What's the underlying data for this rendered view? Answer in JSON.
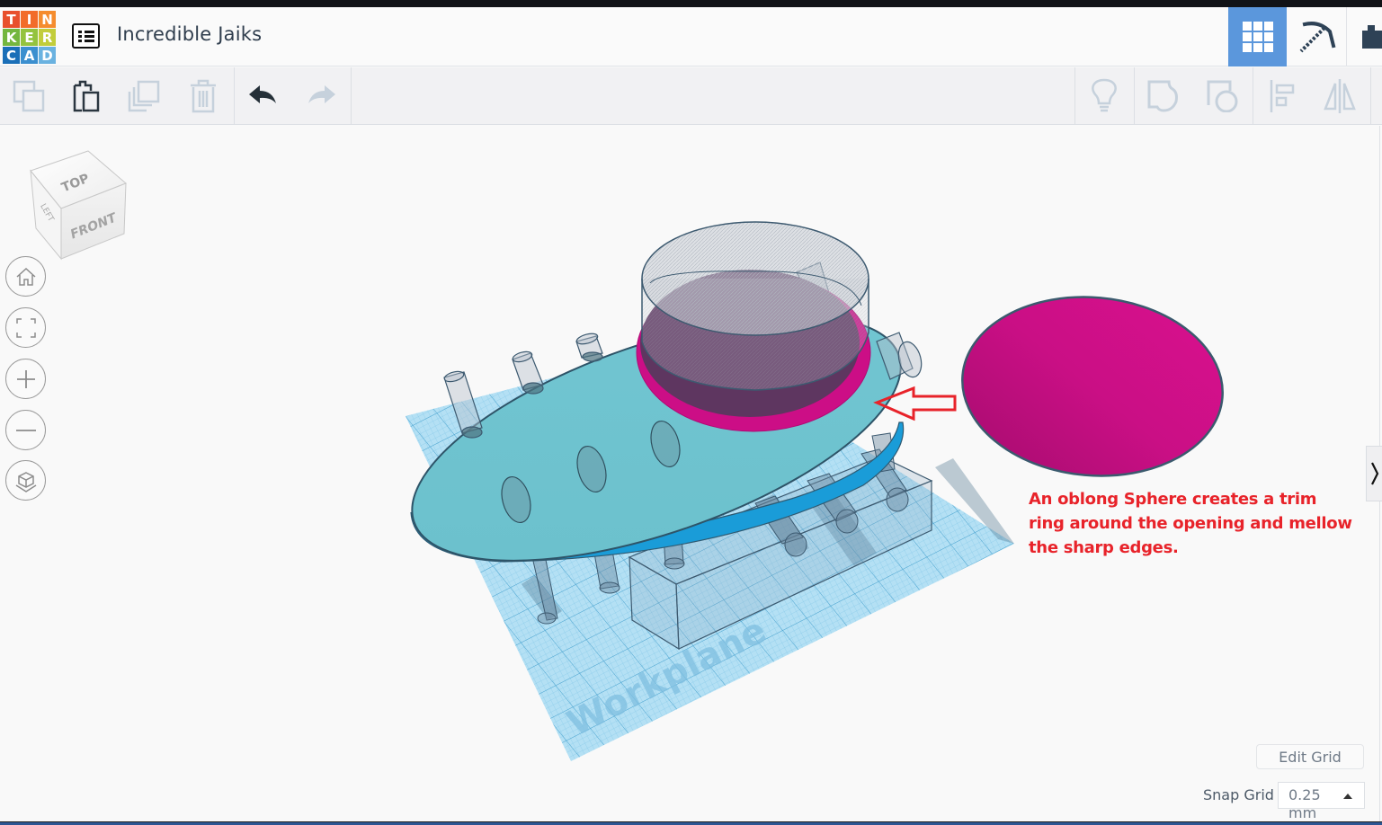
{
  "app": {
    "logo_letters": [
      "T",
      "I",
      "N",
      "K",
      "E",
      "R",
      "C",
      "A",
      "D"
    ],
    "logo_colors": [
      "#e8502d",
      "#f26c2a",
      "#f58c2e",
      "#74b63f",
      "#94c33e",
      "#c2cd3b",
      "#1a6fb8",
      "#3b8fcf",
      "#6ab2e0"
    ],
    "title": "Incredible Jaiks"
  },
  "view_tabs": [
    {
      "name": "3d-design",
      "icon": "grid-icon",
      "active": true
    },
    {
      "name": "blocks",
      "icon": "pickaxe-icon",
      "active": false
    },
    {
      "name": "bricks",
      "icon": "brick-icon",
      "active": false
    }
  ],
  "toolbar": {
    "left": [
      {
        "name": "copy",
        "icon": "copy-icon",
        "enabled": false
      },
      {
        "name": "paste",
        "icon": "paste-icon",
        "enabled": true
      },
      {
        "name": "duplicate",
        "icon": "duplicate-icon",
        "enabled": false
      },
      {
        "name": "delete",
        "icon": "trash-icon",
        "enabled": false
      },
      {
        "name": "undo",
        "icon": "undo-icon",
        "enabled": true
      },
      {
        "name": "redo",
        "icon": "redo-icon",
        "enabled": false
      }
    ],
    "right": [
      {
        "name": "notes",
        "icon": "lightbulb-icon",
        "enabled": false
      },
      {
        "name": "group",
        "icon": "group-icon",
        "enabled": false
      },
      {
        "name": "ungroup",
        "icon": "ungroup-icon",
        "enabled": false
      },
      {
        "name": "align",
        "icon": "align-icon",
        "enabled": false
      },
      {
        "name": "mirror",
        "icon": "mirror-icon",
        "enabled": false
      }
    ]
  },
  "viewcube": {
    "top": "TOP",
    "front": "FRONT",
    "left": "LEFT"
  },
  "nav_controls": [
    {
      "name": "home-view",
      "icon": "home-icon"
    },
    {
      "name": "fit-all",
      "icon": "fit-icon"
    },
    {
      "name": "zoom-in",
      "icon": "plus-icon"
    },
    {
      "name": "zoom-out",
      "icon": "minus-icon"
    },
    {
      "name": "projection",
      "icon": "perspective-cube-icon"
    }
  ],
  "workplane": {
    "label": "Workplane"
  },
  "annotation": {
    "text": "An oblong Sphere creates a trim ring around the opening and mellow the sharp edges.",
    "color": "#e8232a"
  },
  "colors": {
    "accent": "#5b97dc",
    "body_teal": "#6cc3cf",
    "body_underside": "#1a9cd8",
    "sphere_magenta": "#d1108b",
    "hole_purple": "#5e3660",
    "workplane_blue": "#8fd0ef"
  },
  "grid": {
    "edit_label": "Edit Grid",
    "snap_label": "Snap Grid",
    "snap_value": "0.25 mm"
  }
}
